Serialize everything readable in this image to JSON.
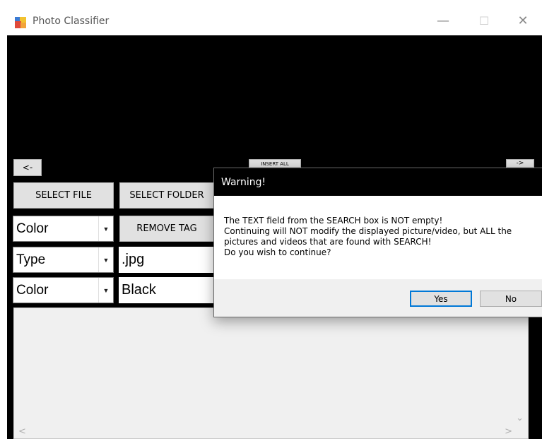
{
  "window": {
    "title": "Photo Classifier",
    "minimize": "—",
    "maximize": "☐",
    "close": "✕"
  },
  "nav": {
    "prev_label": "<-",
    "insert_all_label": "INSERT ALL",
    "next_label": "->"
  },
  "buttons": {
    "select_file": "SELECT FILE",
    "select_folder": "SELECT FOLDER",
    "remove_tag": "REMOVE TAG"
  },
  "tag_rows": [
    {
      "combo": "Color",
      "value": ""
    },
    {
      "combo": "Type",
      "value": ".jpg"
    },
    {
      "combo": "Color",
      "value": "Black"
    }
  ],
  "listbox": {
    "scroll_up": "⌃",
    "scroll_down": "⌄",
    "scroll_left": "<",
    "scroll_right": ">"
  },
  "dialog": {
    "title": "Warning!",
    "message_lines": [
      "The TEXT field from the SEARCH box is NOT empty!",
      "Continuing will NOT modify the displayed picture/video, but ALL the",
      "pictures and videos that are found with SEARCH!",
      "Do you wish to continue?"
    ],
    "yes_label": "Yes",
    "no_label": "No"
  },
  "colors": {
    "background": "#000000",
    "button": "#e1e1e1",
    "dialog_focus": "#0078d7"
  }
}
